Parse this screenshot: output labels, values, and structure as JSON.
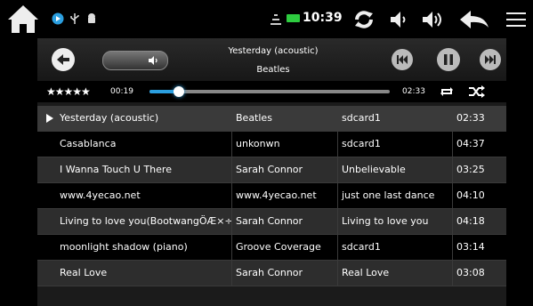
{
  "status_bar": {
    "time": "10:39",
    "icons": [
      "home-icon",
      "play-circle-icon",
      "usb-icon",
      "android-icon",
      "signal-icon",
      "battery-icon",
      "sync-icon",
      "volume-down-icon",
      "volume-up-icon",
      "back-icon",
      "menu-icon"
    ]
  },
  "player": {
    "now_playing_title": "Yesterday (acoustic)",
    "now_playing_artist": "Beatles",
    "rating": "★★★★★",
    "current_time": "00:19",
    "duration": "02:33",
    "progress_fraction": 0.124,
    "accent_color": "#2b9fe0"
  },
  "playlist": {
    "rows": [
      {
        "title": "Yesterday (acoustic)",
        "artist": "Beatles",
        "album": "sdcard1",
        "length": "02:33",
        "current": true
      },
      {
        "title": "Casablanca",
        "artist": "unkonwn",
        "album": "sdcard1",
        "length": "04:37",
        "current": false
      },
      {
        "title": "I Wanna Touch U There",
        "artist": "Sarah Connor",
        "album": "Unbelievable",
        "length": "03:25",
        "current": false
      },
      {
        "title": "www.4yecao.net",
        "artist": "www.4yecao.net",
        "album": "just one last dance",
        "length": "04:10",
        "current": false
      },
      {
        "title": "Living to love you(BootwangÖÆ×÷)",
        "artist": "Sarah Connor",
        "album": "Living to love you",
        "length": "04:18",
        "current": false
      },
      {
        "title": "moonlight shadow (piano)",
        "artist": "Groove Coverage",
        "album": "sdcard1",
        "length": "03:14",
        "current": false
      },
      {
        "title": "Real Love",
        "artist": "Sarah Connor",
        "album": "Real Love",
        "length": "03:08",
        "current": false
      }
    ]
  }
}
